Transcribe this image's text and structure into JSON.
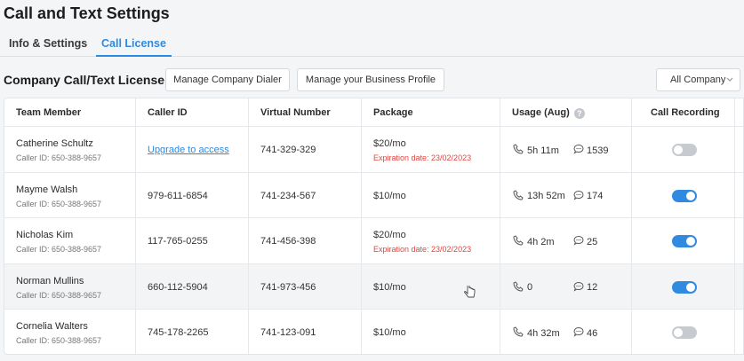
{
  "header": {
    "title": "Call and Text Settings"
  },
  "tabs": [
    {
      "label": "Info & Settings"
    },
    {
      "label": "Call License"
    }
  ],
  "section": {
    "title": "Company Call/Text License"
  },
  "toolbar": {
    "dialer_label": "Manage Company Dialer",
    "profile_label": "Manage your Business Profile",
    "company_select": "All Company"
  },
  "table": {
    "columns": [
      "Team Member",
      "Caller ID",
      "Virtual Number",
      "Package",
      "Usage (Aug)",
      "Call Recording"
    ],
    "rows": [
      {
        "name": "Catherine Schultz",
        "caller_sub": "Caller ID: 650-388-9657",
        "caller_id": "Upgrade to access",
        "virtual": "741-329-329",
        "package": "$20/mo",
        "expiration": "Expiration date: 23/02/2023",
        "usage_time": "5h 11m",
        "usage_sms": "1539",
        "recording": false
      },
      {
        "name": "Mayme Walsh",
        "caller_sub": "Caller ID: 650-388-9657",
        "caller_id": "979-611-6854",
        "virtual": "741-234-567",
        "package": "$10/mo",
        "usage_time": "13h 52m",
        "usage_sms": "174",
        "recording": true
      },
      {
        "name": "Nicholas Kim",
        "caller_sub": "Caller ID: 650-388-9657",
        "caller_id": "117-765-0255",
        "virtual": "741-456-398",
        "package": "$20/mo",
        "expiration": "Expiration date: 23/02/2023",
        "usage_time": "4h 2m",
        "usage_sms": "25",
        "recording": true
      },
      {
        "name": "Norman Mullins",
        "caller_sub": "Caller ID: 650-388-9657",
        "caller_id": "660-112-5904",
        "virtual": "741-973-456",
        "package": "$10/mo",
        "usage_time": "0",
        "usage_sms": "12",
        "recording": true
      },
      {
        "name": "Cornelia Walters",
        "caller_sub": "Caller ID: 650-388-9657",
        "caller_id": "745-178-2265",
        "virtual": "741-123-091",
        "package": "$10/mo",
        "usage_time": "4h 32m",
        "usage_sms": "46",
        "recording": false
      }
    ]
  },
  "colors": {
    "accent": "#2a8be6",
    "toggle_on": "#2f8ae0",
    "toggle_off": "#c7cacf",
    "expiration": "#e0453f"
  }
}
